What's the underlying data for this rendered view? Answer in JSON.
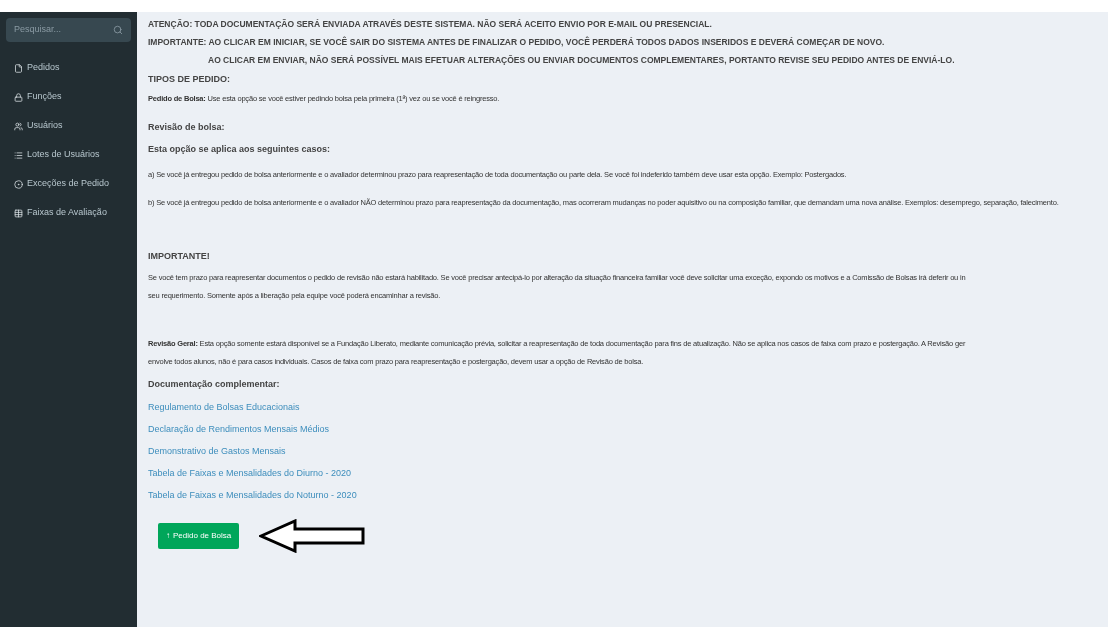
{
  "sidebar": {
    "search": {
      "placeholder": "Pesquisar..."
    },
    "items": [
      {
        "label": "Pedidos"
      },
      {
        "label": "Funções"
      },
      {
        "label": "Usuários"
      },
      {
        "label": "Lotes de Usuários"
      },
      {
        "label": "Exceções de Pedido"
      },
      {
        "label": "Faixas de Avaliação"
      }
    ]
  },
  "notices": [
    {
      "text": "ATENÇÃO: TODA DOCUMENTAÇÃO SERÁ ENVIADA ATRAVÉS DESTE SISTEMA. NÃO SERÁ ACEITO ENVIO POR E-MAIL OU PRESENCIAL.",
      "indent": false
    },
    {
      "text": "IMPORTANTE: AO CLICAR EM INICIAR, SE VOCÊ SAIR DO SISTEMA ANTES DE FINALIZAR O PEDIDO, VOCÊ PERDERÁ TODOS DADOS INSERIDOS E DEVERÁ COMEÇAR DE NOVO.",
      "indent": false
    },
    {
      "text": "AO CLICAR EM ENVIAR, NÃO SERÁ POSSÍVEL MAIS EFETUAR ALTERAÇÕES OU ENVIAR DOCUMENTOS COMPLEMENTARES, PORTANTO REVISE SEU PEDIDO ANTES DE ENVIÁ-LO.",
      "indent": true
    }
  ],
  "types_title": "TIPOS DE PEDIDO:",
  "pedido_bolsa": "**Pedido de Bolsa:** Use esta opção se você estiver pedindo bolsa pela primeira (1ª) vez ou se você é reingresso.",
  "revisao": {
    "title": "Revisão de bolsa:",
    "subtitle": "Esta opção se aplica aos seguintes casos:",
    "cases": [
      "a)   Se você já entregou pedido de bolsa anteriormente e o avaliador determinou prazo para reapresentação de toda documentação ou parte dela. Se você foi indeferido também deve usar esta opção. Exemplo: Postergados.",
      "b)   Se você já entregou pedido de bolsa anteriormente e o avaliador NÃO determinou prazo para reapresentação da documentação, mas ocorreram mudanças no poder aquisitivo ou na composição familiar, que demandam uma nova análise. Exemplos: desemprego, separação, falecimento."
    ]
  },
  "importante": {
    "title": "IMPORTANTE!",
    "text": "Se você tem prazo para reapresentar documentos o pedido de revisão não estará habilitado. Se você precisar antecipá-lo por alteração da situação financeira familiar você deve solicitar uma exceção, expondo os motivos e a Comissão de Bolsas irá deferir ou in",
    "text2": "seu requerimento. Somente após a liberação pela equipe você poderá encaminhar a revisão."
  },
  "revisao_geral": "**Revisão Geral:** Esta opção somente estará disponível se a Fundação Liberato, mediante comunicação prévia, solicitar a reapresentação de toda documentação para fins de atualização. Não se aplica nos casos de faixa com prazo e postergação. A Revisão ger",
  "revisao_geral2": "envolve todos alunos, não é para casos individuais. Casos de faixa com prazo para reapresentação e postergação, devem usar a opção de Revisão de bolsa.",
  "docs_title": "Documentação complementar:",
  "links": [
    "Regulamento de Bolsas Educacionais",
    "Declaração de Rendimentos Mensais Médios",
    "Demonstrativo de Gastos Mensais",
    "Tabela de Faixas e Mensalidades do Diurno - 2020",
    "Tabela de Faixas e Mensalidades do Noturno - 2020"
  ],
  "button": {
    "icon": "↑",
    "label": "Pedido de Bolsa"
  }
}
